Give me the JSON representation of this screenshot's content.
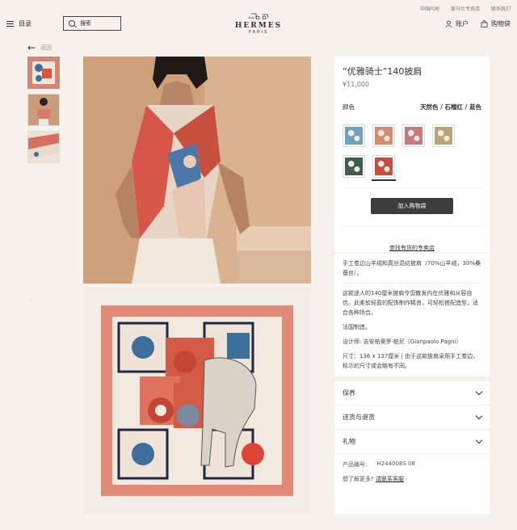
{
  "header": {
    "top_links": [
      "中国内地",
      "爱马仕专卖店",
      "联系我们"
    ],
    "menu_label": "目录",
    "search_placeholder": "搜索",
    "logo_name": "HERMES",
    "logo_city": "PARIS",
    "account_label": "账户",
    "bag_label": "购物袋"
  },
  "nav": {
    "back_label": "返回"
  },
  "product": {
    "title": "“优雅骑士”140披肩",
    "price": "¥11,000",
    "color_label": "颜色",
    "color_value": "天然色 / 石榴红 / 蓝色",
    "swatch_colors": [
      "#6ea3c0",
      "#d58b6d",
      "#c7797b",
      "#b9a47a",
      "#3f5c4f",
      "#c44d3e"
    ],
    "selected_swatch": 5,
    "add_to_bag": "加入购物袋",
    "find_store": "查找有货的专卖店"
  },
  "description": {
    "material": "手工卷边山羊绒和真丝混纺披肩（70%山羊绒，30%桑蚕丝）。",
    "body": "这款迷人的140厘米披肩令您散发内在优雅和从容自信。此柔软轻盈的配饰制作精良，可轻松搭配造型，适合各种场合。",
    "made_in": "法国制造。",
    "designer": "设计师: 吉安帕奥罗·帕尼（Gianpaolo Pagni）",
    "size": "尺寸：136 x 137厘米 | 由于这款披肩采用手工卷边，标示的尺寸或会略有不同。"
  },
  "accordion": {
    "care": "保养",
    "delivery": "送货与退货",
    "gift": "礼物"
  },
  "reference": {
    "label": "产品编号:",
    "value": "H244008S 08"
  },
  "contact": {
    "question": "想了解更多?",
    "link": "请联系客服"
  }
}
